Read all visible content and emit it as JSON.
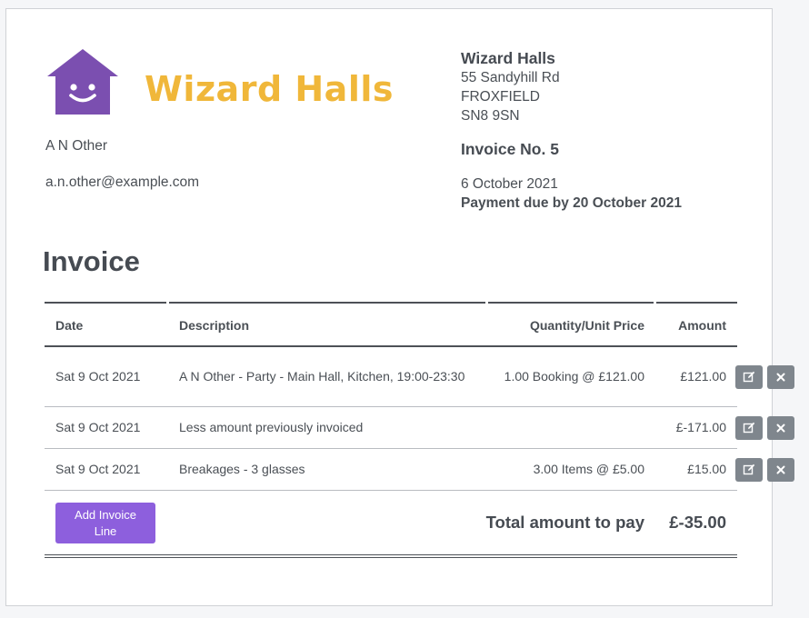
{
  "brand": {
    "logo_text": "Wizard Halls",
    "logo_color": "#f0b73a",
    "house_color": "#7b4fb0",
    "icon": "smiling-house-logo"
  },
  "company": {
    "name": "Wizard Halls",
    "address_line1": "55 Sandyhill Rd",
    "address_line2": "FROXFIELD",
    "postcode": "SN8 9SN"
  },
  "invoice": {
    "number_label": "Invoice No. 5",
    "date": "6 October 2021",
    "due": "Payment due by 20 October 2021",
    "title": "Invoice"
  },
  "customer": {
    "name": "A N Other",
    "email": "a.n.other@example.com"
  },
  "table": {
    "headers": {
      "date": "Date",
      "description": "Description",
      "quantity": "Quantity/Unit Price",
      "amount": "Amount"
    },
    "rows": [
      {
        "date": "Sat 9 Oct 2021",
        "description": "A N Other - Party - Main Hall, Kitchen, 19:00-23:30",
        "quantity": "1.00 Booking @ £121.00",
        "amount": "£121.00"
      },
      {
        "date": "Sat 9 Oct 2021",
        "description": "Less amount previously invoiced",
        "quantity": "",
        "amount": "£-171.00"
      },
      {
        "date": "Sat 9 Oct 2021",
        "description": "Breakages - 3 glasses",
        "quantity": "3.00 Items @ £5.00",
        "amount": "£15.00"
      }
    ],
    "add_button_label": "Add Invoice Line",
    "total_label": "Total amount to pay",
    "total_amount": "£-35.00"
  },
  "colors": {
    "accent_button": "#8d5fdd",
    "action_button": "#7f868d",
    "text": "#4a4f55"
  },
  "icons": {
    "edit": "edit-icon",
    "delete": "close-icon"
  }
}
